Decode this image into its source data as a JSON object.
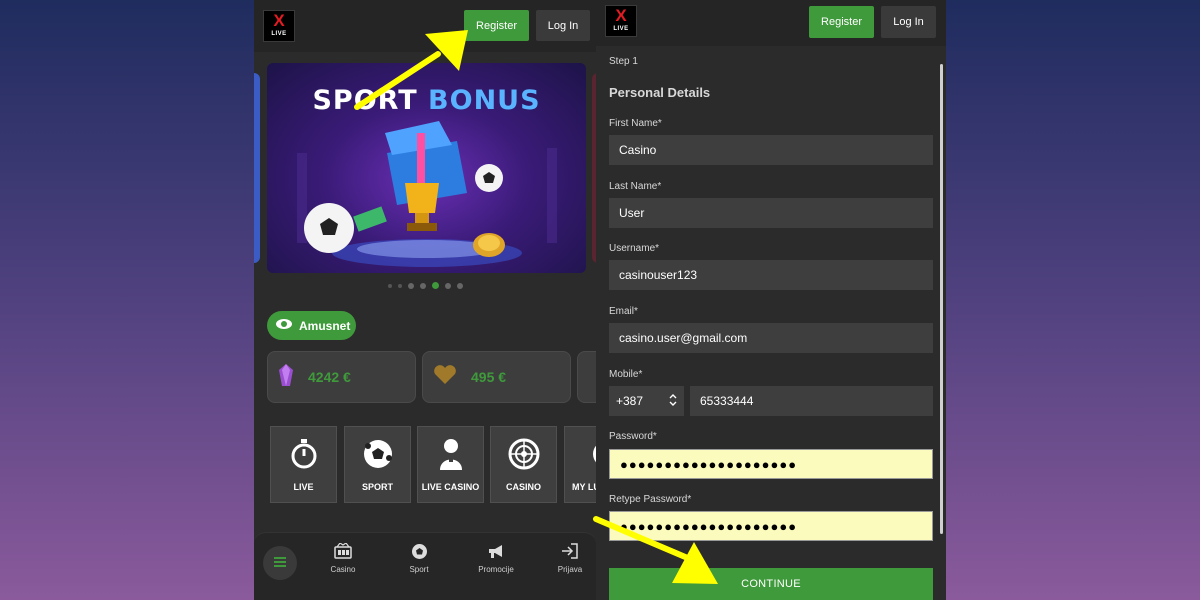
{
  "logo": {
    "mark": "X",
    "sub": "LIVE"
  },
  "header": {
    "register_label": "Register",
    "login_label": "Log In"
  },
  "banner": {
    "title_part1": "SPORT",
    "title_part2": "BONUS"
  },
  "carousel": {
    "count": 7,
    "active_index": 4
  },
  "provider_pill": {
    "label": "Amusnet",
    "icon": "eye-icon"
  },
  "jackpots": [
    {
      "icon": "purple-gem-icon",
      "value": "4242 €"
    },
    {
      "icon": "gold-heart-icon",
      "value": "495 €"
    }
  ],
  "categories": [
    {
      "label": "LIVE",
      "icon": "stopwatch-icon"
    },
    {
      "label": "SPORT",
      "icon": "soccer-ball-icon"
    },
    {
      "label": "LIVE CASINO",
      "icon": "dealer-icon"
    },
    {
      "label": "CASINO",
      "icon": "roulette-icon"
    },
    {
      "label": "MY LU",
      "icon": "lucky-icon"
    }
  ],
  "bottom_nav": [
    {
      "label": "Casino",
      "icon": "slot-machine-icon"
    },
    {
      "label": "Sport",
      "icon": "soccer-ball-icon"
    },
    {
      "label": "Promocije",
      "icon": "megaphone-icon"
    },
    {
      "label": "Prijava",
      "icon": "login-icon"
    }
  ],
  "form": {
    "step": "Step 1",
    "section_title": "Personal Details",
    "first_name": {
      "label": "First Name*",
      "value": "Casino"
    },
    "last_name": {
      "label": "Last Name*",
      "value": "User"
    },
    "username": {
      "label": "Username*",
      "value": "casinouser123"
    },
    "email": {
      "label": "Email*",
      "value": "casino.user@gmail.com"
    },
    "mobile": {
      "label": "Mobile*",
      "country_code": "+387",
      "value": "65333444"
    },
    "password": {
      "label": "Password*",
      "value": "●●●●●●●●●●●●●●●●●●●●"
    },
    "retype_password": {
      "label": "Retype Password*",
      "value": "●●●●●●●●●●●●●●●●●●●●"
    },
    "continue_label": "CONTINUE"
  },
  "colors": {
    "accent_green": "#3f9a3b",
    "annotation_arrow": "#ffff00",
    "password_autofill": "#fbfbbd"
  }
}
